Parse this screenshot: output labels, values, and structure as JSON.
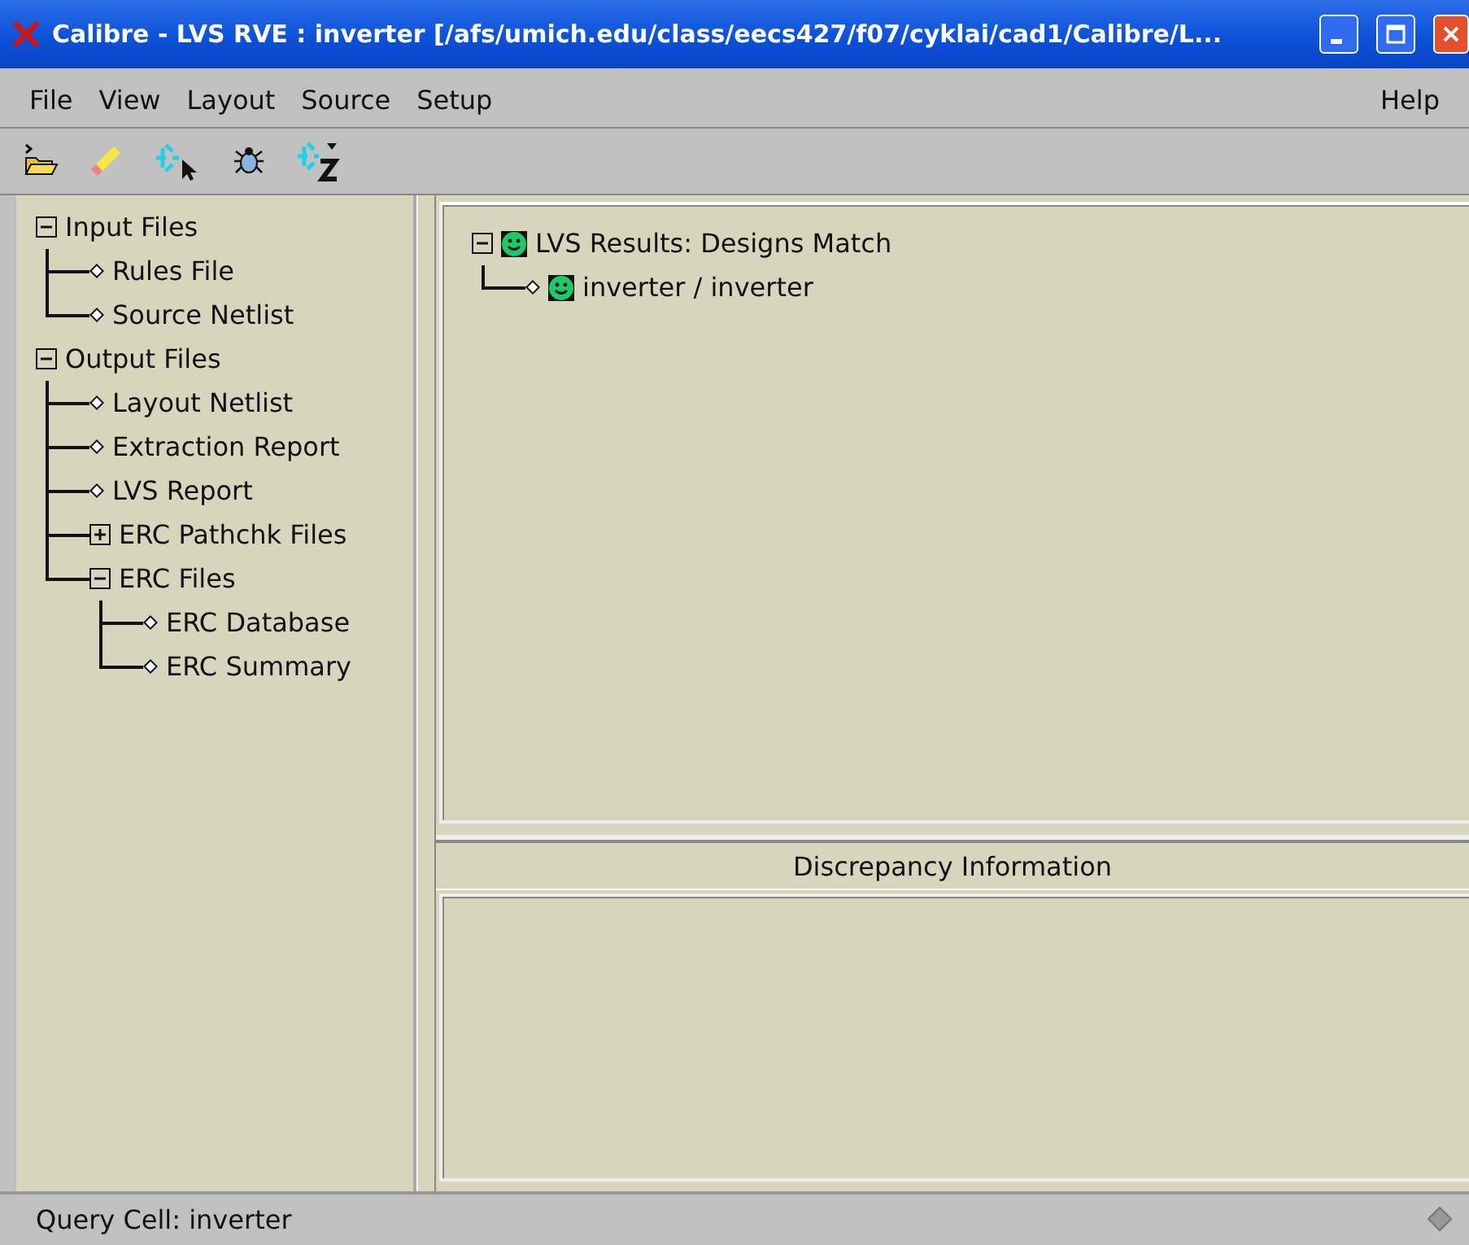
{
  "window": {
    "title": "Calibre - LVS RVE : inverter [/afs/umich.edu/class/eecs427/f07/cyklai/cad1/Calibre/L..."
  },
  "menu": {
    "items": [
      "File",
      "View",
      "Layout",
      "Source",
      "Setup"
    ],
    "help": "Help"
  },
  "file_tree": [
    {
      "label": "Input Files",
      "expanded": true,
      "children": [
        {
          "label": "Rules File"
        },
        {
          "label": "Source Netlist"
        }
      ]
    },
    {
      "label": "Output Files",
      "expanded": true,
      "children": [
        {
          "label": "Layout Netlist"
        },
        {
          "label": "Extraction Report"
        },
        {
          "label": "LVS Report"
        },
        {
          "label": "ERC Pathchk Files",
          "expanded": false
        },
        {
          "label": "ERC Files",
          "expanded": true,
          "children": [
            {
              "label": "ERC Database"
            },
            {
              "label": "ERC Summary"
            }
          ]
        }
      ]
    }
  ],
  "results_tree": [
    {
      "label": "LVS Results: Designs Match",
      "expanded": true,
      "children": [
        {
          "label": "inverter / inverter"
        }
      ]
    }
  ],
  "discrepancy": {
    "title": "Discrepancy Information"
  },
  "status_bar": {
    "text": "Query Cell: inverter"
  }
}
